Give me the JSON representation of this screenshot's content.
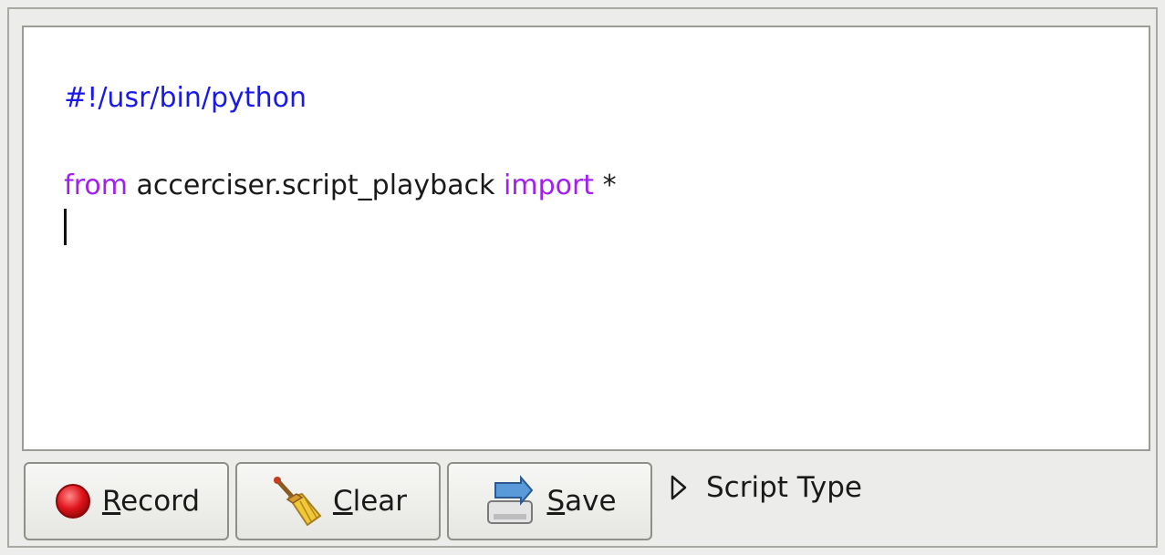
{
  "editor": {
    "lines": [
      {
        "parts": [
          {
            "text": "#!/usr/bin/python",
            "style": "shebang"
          }
        ]
      },
      {
        "parts": []
      },
      {
        "parts": [
          {
            "text": "from",
            "style": "kw"
          },
          {
            "text": " accerciser.script_playback ",
            "style": "plain"
          },
          {
            "text": "import",
            "style": "kw"
          },
          {
            "text": " *",
            "style": "plain"
          }
        ]
      },
      {
        "parts": []
      }
    ]
  },
  "buttons": {
    "record": {
      "mnemonic": "R",
      "rest": "ecord",
      "icon": "record-icon"
    },
    "clear": {
      "mnemonic": "C",
      "rest": "lear",
      "icon": "broom-icon"
    },
    "save": {
      "mnemonic": "S",
      "rest": "ave",
      "icon": "save-icon"
    }
  },
  "expander": {
    "label": "Script Type",
    "icon": "triangle-right-icon"
  },
  "colors": {
    "shebang": "#1a1ae8",
    "keyword": "#a020f0",
    "record": "#e0141c"
  }
}
